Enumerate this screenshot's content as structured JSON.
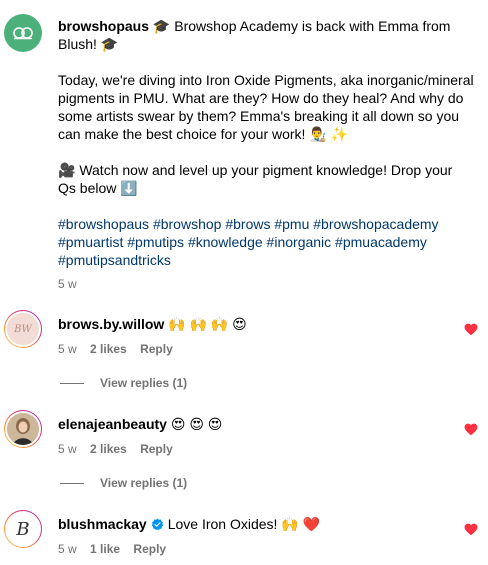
{
  "post": {
    "username": "browshopaus",
    "line1": " Browshop Academy is back with Emma from",
    "line2": "Blush! ",
    "para_lines": [
      "Today, we're diving into Iron Oxide Pigments, aka inorganic/mineral",
      "pigments in PMU. What are they? How do they heal? And why do",
      "some artists swear by them? Emma's breaking it all down so you",
      "can make the best choice for your work! "
    ],
    "watch_lines": [
      " Watch now and level up your pigment knowledge! Drop your",
      "Qs below "
    ],
    "hashtag_lines": [
      "#browshopaus #browshop #brows #pmu #browshopacademy",
      "#pmuartist #pmutips #knowledge #inorganic #pmuacademy",
      "#pmutipsandtricks"
    ],
    "time": "5 w",
    "emoji": {
      "grad_cap": "🎓",
      "artist": "👨‍🎨",
      "sparkles": "✨",
      "camera": "🎥",
      "down_arrow": "⬇️"
    }
  },
  "comments": [
    {
      "username": "brows.by.willow",
      "text": "🙌 🙌 🙌 😍",
      "time": "5 w",
      "likes": "2 likes",
      "reply_label": "Reply",
      "view_replies": "View replies (1)",
      "avatar_letters": "BW"
    },
    {
      "username": "elenajeanbeauty",
      "text": "😍 😍 😍",
      "time": "5 w",
      "likes": "2 likes",
      "reply_label": "Reply",
      "view_replies": "View replies (1)"
    },
    {
      "username": "blushmackay",
      "text": "Love Iron Oxides! 🙌 ❤️",
      "time": "5 w",
      "likes": "1 like",
      "reply_label": "Reply",
      "verified": true,
      "avatar_letters": "B"
    }
  ],
  "colors": {
    "link": "#00376b",
    "meta": "#737373",
    "heart": "#ff3040",
    "verified": "#0095f6",
    "brand_green": "#4cb07a"
  }
}
